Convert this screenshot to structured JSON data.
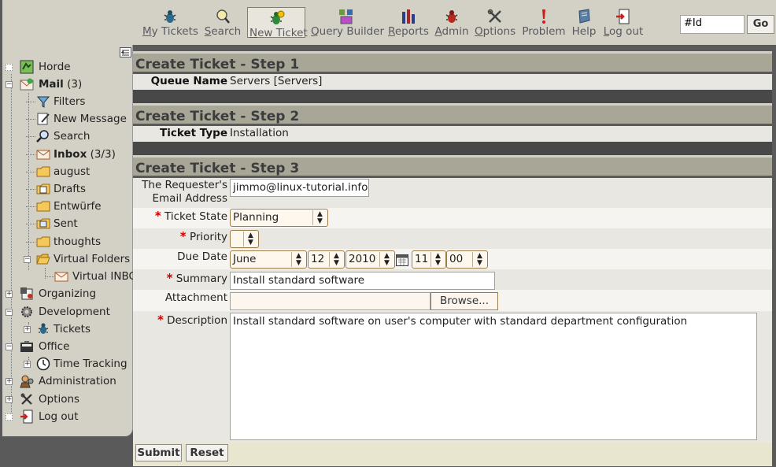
{
  "toolbar": {
    "items": [
      {
        "label": "My Tickets",
        "ul": "M",
        "rest": "y Tickets"
      },
      {
        "label": "Search",
        "ul": "S",
        "rest": "earch"
      },
      {
        "label": "New Ticket",
        "ul": "N",
        "rest": "ew Ticket"
      },
      {
        "label": "Query Builder",
        "ul": "Q",
        "rest": "uery Builder"
      },
      {
        "label": "Reports",
        "ul": "R",
        "rest": "eports"
      },
      {
        "label": "Admin",
        "ul": "A",
        "rest": "dmin"
      },
      {
        "label": "Options",
        "ul": "O",
        "rest": "ptions"
      },
      {
        "label": "Problem",
        "ul": "",
        "rest": "Problem"
      },
      {
        "label": "Help",
        "ul": "",
        "rest": "Help"
      },
      {
        "label": "Log out",
        "ul": "L",
        "rest": "og out"
      }
    ],
    "ticket_search_value": "#Id",
    "go_label": "Go",
    "icons": [
      "my-tickets-icon",
      "search-icon",
      "new-ticket-icon",
      "query-builder-icon",
      "reports-icon",
      "admin-icon",
      "options-icon",
      "problem-icon",
      "help-icon",
      "logout-icon"
    ]
  },
  "sidebar": {
    "items": [
      {
        "label": "Horde",
        "icon": "horde-icon"
      },
      {
        "label": "Mail",
        "count": "(3)",
        "icon": "mail-icon"
      },
      {
        "label": "Filters",
        "icon": "filter-icon"
      },
      {
        "label": "New Message",
        "icon": "compose-icon"
      },
      {
        "label": "Search",
        "icon": "magnifier-icon"
      },
      {
        "label": "Inbox",
        "count": "(3/3)",
        "icon": "inbox-icon"
      },
      {
        "label": "august",
        "icon": "folder-icon"
      },
      {
        "label": "Drafts",
        "icon": "drafts-icon"
      },
      {
        "label": "Entwürfe",
        "icon": "folder-icon"
      },
      {
        "label": "Sent",
        "icon": "sent-icon"
      },
      {
        "label": "thoughts",
        "icon": "folder-icon"
      },
      {
        "label": "Virtual Folders",
        "icon": "folder-open-icon"
      },
      {
        "label": "Virtual INBOX",
        "icon": "envelope-icon"
      },
      {
        "label": "Organizing",
        "icon": "organizing-icon"
      },
      {
        "label": "Development",
        "icon": "gear-icon"
      },
      {
        "label": "Tickets",
        "icon": "bug-icon"
      },
      {
        "label": "Office",
        "icon": "office-icon"
      },
      {
        "label": "Time Tracking",
        "icon": "clock-icon"
      },
      {
        "label": "Administration",
        "icon": "admin-icon"
      },
      {
        "label": "Options",
        "icon": "tools-icon"
      },
      {
        "label": "Log out",
        "icon": "logout-icon"
      }
    ]
  },
  "form": {
    "step1": {
      "title": "Create Ticket - Step 1",
      "label": "Queue Name",
      "value": "Servers [Servers]"
    },
    "step2": {
      "title": "Create Ticket - Step 2",
      "label": "Ticket Type",
      "value": "Installation"
    },
    "step3": {
      "title": "Create Ticket - Step 3",
      "requester_label_1": "The Requester's",
      "requester_label_2": "Email Address",
      "requester_value": "jimmo@linux-tutorial.info",
      "state_label": "Ticket State",
      "state_value": "Planning",
      "priority_label": "Priority",
      "priority_value": "",
      "due_label": "Due Date",
      "due_month": "June",
      "due_day": "12",
      "due_year": "2010",
      "due_hour": "11",
      "due_minute": "00",
      "summary_label": "Summary",
      "summary_value": "Install standard software",
      "attachment_label": "Attachment",
      "attachment_value": "",
      "browse_label": "Browse...",
      "description_label": "Description",
      "description_value": "Install standard software on user's computer with standard department configuration",
      "required_mark": "*"
    },
    "submit_label": "Submit",
    "reset_label": "Reset"
  },
  "colors": {
    "header_bg": "#a8a696",
    "toolbar_bg": "#d3d1c5",
    "required": "#c80000",
    "select_border": "#9a7d4a"
  }
}
